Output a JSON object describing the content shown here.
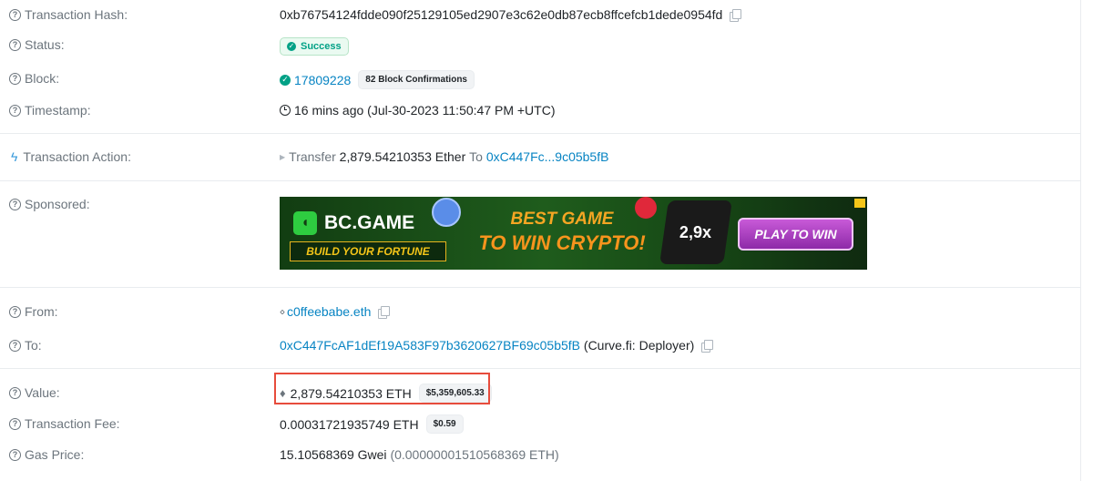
{
  "rows": {
    "tx_hash": {
      "label": "Transaction Hash:",
      "value": "0xb76754124fdde090f25129105ed2907e3c62e0db87ecb8ffcefcb1dede0954fd"
    },
    "status": {
      "label": "Status:",
      "value": "Success"
    },
    "block": {
      "label": "Block:",
      "number": "17809228",
      "confirmations": "82 Block Confirmations"
    },
    "timestamp": {
      "label": "Timestamp:",
      "value": "16 mins ago (Jul-30-2023 11:50:47 PM +UTC)"
    },
    "action": {
      "label": "Transaction Action:",
      "verb": "Transfer",
      "amount": "2,879.54210353",
      "unit": "Ether",
      "to_word": "To",
      "to_address": "0xC447Fc...9c05b5fB"
    },
    "sponsored": {
      "label": "Sponsored:"
    },
    "from": {
      "label": "From:",
      "value": "c0ffeebabe.eth"
    },
    "to": {
      "label": "To:",
      "address": "0xC447FcAF1dEf19A583F97b3620627BF69c05b5fB",
      "tag": "(Curve.fi: Deployer)"
    },
    "value": {
      "label": "Value:",
      "amount": "2,879.54210353 ETH",
      "usd": "$5,359,605.33"
    },
    "fee": {
      "label": "Transaction Fee:",
      "amount": "0.00031721935749 ETH",
      "usd": "$0.59"
    },
    "gas": {
      "label": "Gas Price:",
      "gwei": "15.10568369 Gwei",
      "eth": "(0.00000001510568369 ETH)"
    }
  },
  "ad": {
    "brand": "BC.GAME",
    "tagline": "BUILD YOUR FORTUNE",
    "headline_1": "BEST GAME",
    "headline_2": "TO WIN CRYPTO!",
    "multiplier": "2,9x",
    "cta": "PLAY TO WIN"
  },
  "colors": {
    "link": "#0784c3",
    "success": "#00a186",
    "highlight": "#e74c3c",
    "muted": "#6c757d"
  },
  "icons": [
    "help-icon",
    "copy-icon",
    "check-icon",
    "clock-icon",
    "bolt-icon",
    "eth-icon",
    "code-icon"
  ]
}
